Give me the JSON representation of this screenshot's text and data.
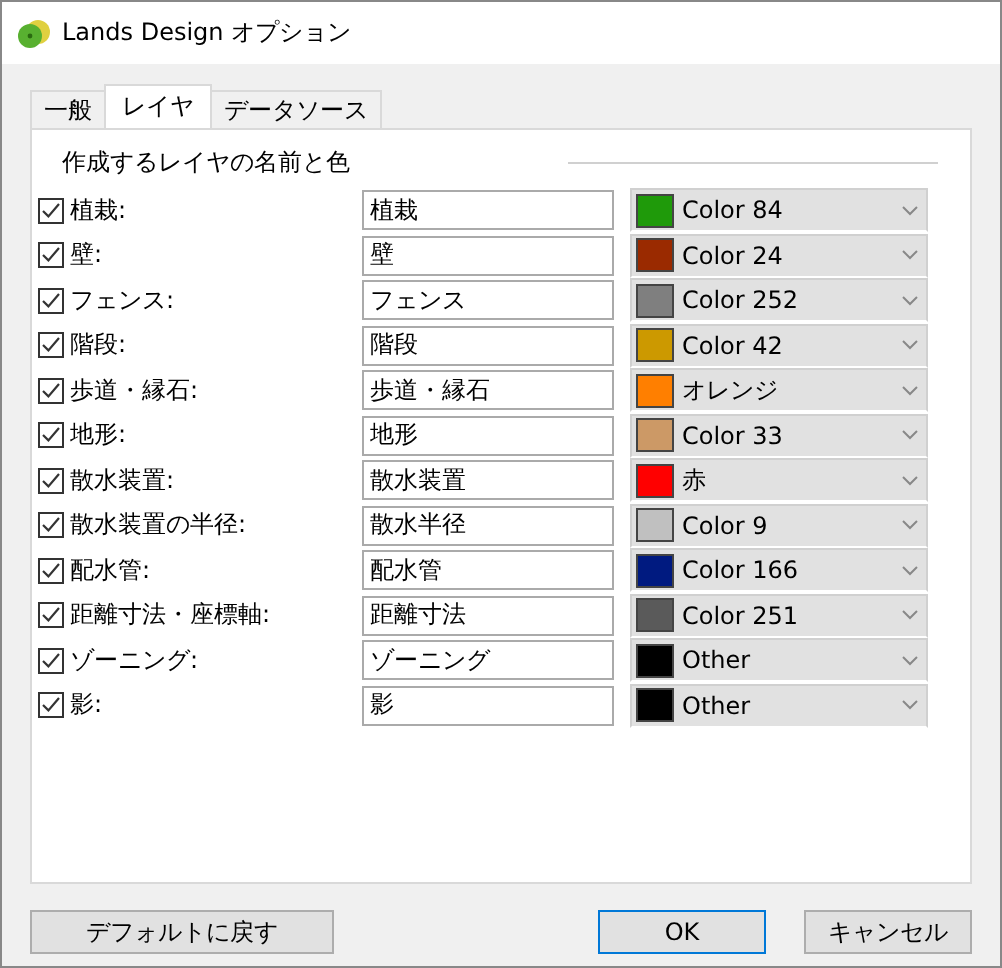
{
  "window": {
    "title": "Lands Design オプション"
  },
  "tabs": [
    {
      "label": "一般",
      "selected": false
    },
    {
      "label": "レイヤ",
      "selected": true
    },
    {
      "label": "データソース",
      "selected": false
    }
  ],
  "group_title": "作成するレイヤの名前と色",
  "layers": [
    {
      "label": "植栽:",
      "checked": true,
      "name": "植栽",
      "color_name": "Color 84",
      "color": "#1f9a0a"
    },
    {
      "label": "壁:",
      "checked": true,
      "name": "壁",
      "color_name": "Color 24",
      "color": "#9a2a00"
    },
    {
      "label": "フェンス:",
      "checked": true,
      "name": "フェンス",
      "color_name": "Color 252",
      "color": "#7f7f7f"
    },
    {
      "label": "階段:",
      "checked": true,
      "name": "階段",
      "color_name": "Color 42",
      "color": "#cc9900"
    },
    {
      "label": "歩道・縁石:",
      "checked": true,
      "name": "歩道・縁石",
      "color_name": "オレンジ",
      "color": "#ff7f00"
    },
    {
      "label": "地形:",
      "checked": true,
      "name": "地形",
      "color_name": "Color 33",
      "color": "#cc9966"
    },
    {
      "label": "散水装置:",
      "checked": true,
      "name": "散水装置",
      "color_name": "赤",
      "color": "#ff0000"
    },
    {
      "label": "散水装置の半径:",
      "checked": true,
      "name": "散水半径",
      "color_name": "Color 9",
      "color": "#c0c0c0"
    },
    {
      "label": "配水管:",
      "checked": true,
      "name": "配水管",
      "color_name": "Color 166",
      "color": "#001a80"
    },
    {
      "label": "距離寸法・座標軸:",
      "checked": true,
      "name": "距離寸法",
      "color_name": "Color 251",
      "color": "#5a5a5a"
    },
    {
      "label": "ゾーニング:",
      "checked": true,
      "name": "ゾーニング",
      "color_name": "Other",
      "color": "#000000"
    },
    {
      "label": "影:",
      "checked": true,
      "name": "影",
      "color_name": "Other",
      "color": "#000000"
    }
  ],
  "buttons": [
    {
      "label": "デフォルトに戻す",
      "kind": "plain"
    },
    {
      "label": "OK",
      "kind": "default"
    },
    {
      "label": "キャンセル",
      "kind": "plain"
    }
  ]
}
